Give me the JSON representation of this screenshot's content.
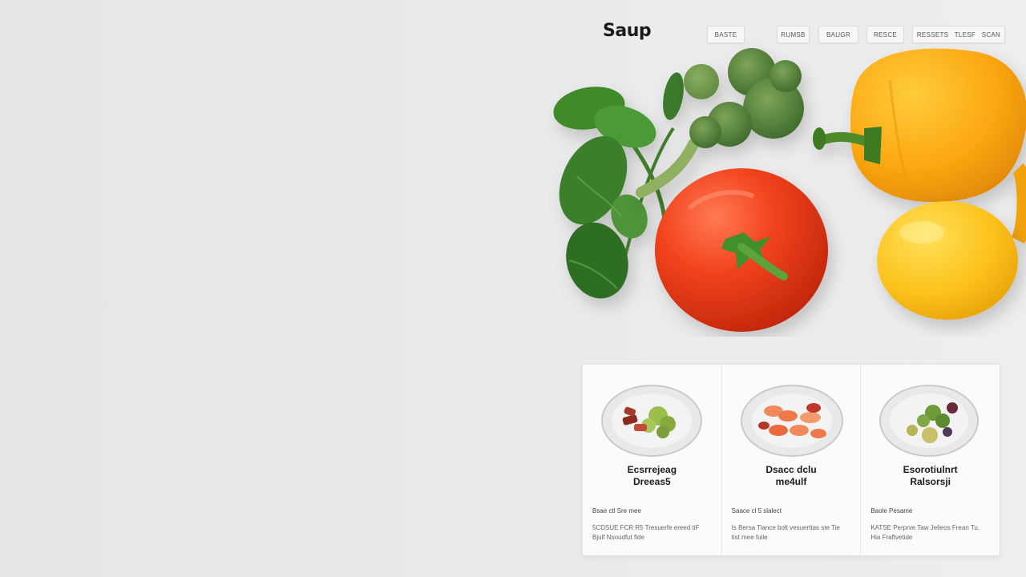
{
  "header": {
    "logo": "Saup",
    "nav": [
      {
        "label": "BASTE"
      },
      {
        "label": "RUMSB"
      },
      {
        "label": "BAUGR"
      },
      {
        "label": "RESCE"
      },
      {
        "label": "RESSETS   TLESF   SCAN"
      }
    ]
  },
  "hero": {
    "items": [
      "spinach-leaves",
      "broccoli",
      "tomato",
      "yellow-bell-pepper",
      "lemon"
    ]
  },
  "cards": [
    {
      "title": "Ecsrrejeag",
      "subtitle": "Dreeas5",
      "meta": "Bsae ctl Sre mee",
      "desc": "5CDSUE FCR R5 Tresuerfe ereed tiF Bjulf Nsoudfut fide"
    },
    {
      "title": "Dsacc dclu",
      "subtitle": "me4ulf",
      "meta": "Saace cl 5 slalect",
      "desc": "Is Bersa Tiance bolt vesuerttas ste Tie tist mee fuile"
    },
    {
      "title": "Esorotiulnrt",
      "subtitle": "Ralsorsji",
      "meta": "Baole Pesame",
      "desc": "KATSE Perprve Taw Jelieos Frean Tu. Hia   Fraftvetide"
    }
  ],
  "colors": {
    "background": "#e9eaeb",
    "card_bg": "#fbfbfb",
    "text_dark": "#1d1d1d"
  }
}
